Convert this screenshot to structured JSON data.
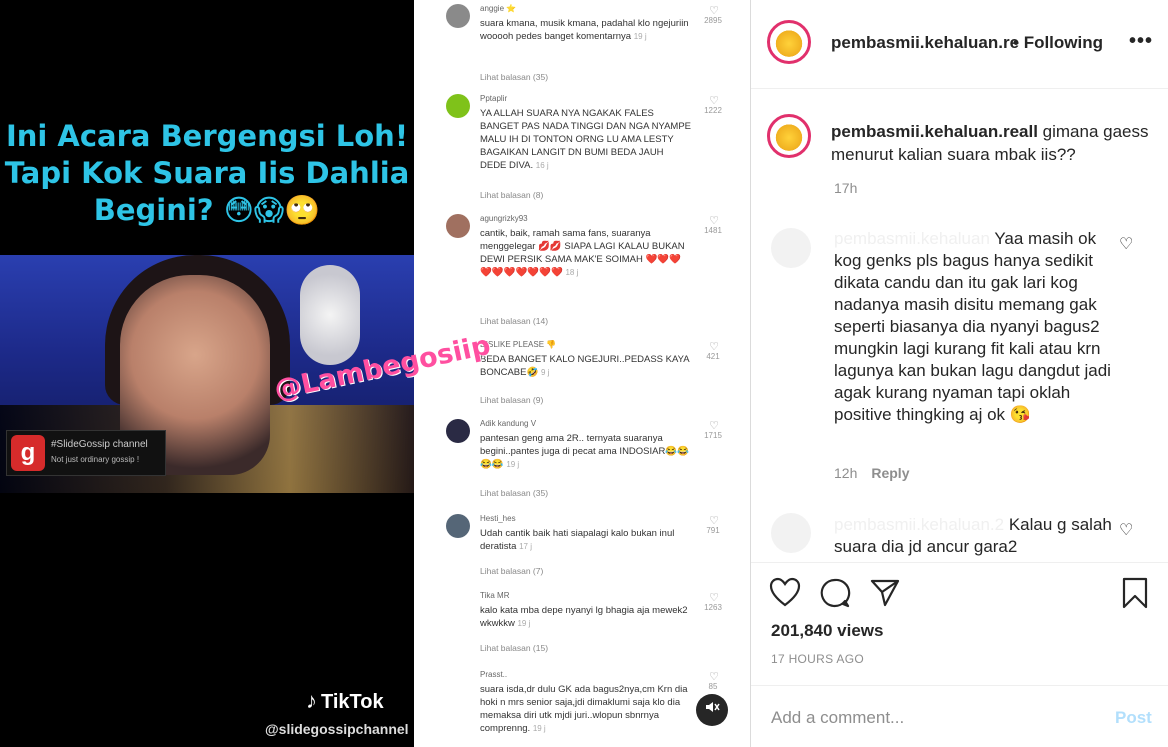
{
  "video": {
    "headline_lines": [
      "Ini Acara Bergengsi Loh!",
      "Tapi Kok Suara Iis Dahlia",
      "Begini? 😳😱🙄"
    ],
    "watermark": "@Lambegosiip",
    "channel_logo_line1": "#SlideGossip channel",
    "channel_logo_line2": "Not just ordinary gossip !",
    "tiktok_label": "TikTok",
    "tiktok_user": "@slidegossipchannel",
    "mute_icon": "mute-icon"
  },
  "video_comments": [
    {
      "user": "anggie ⭐",
      "text": "suara kmana, musik kmana, padahal klo ngejuriin wooooh pedes banget komentarnya",
      "time": "19 j",
      "likes": "2895",
      "replies": "Lihat balasan (35)",
      "avatar_color": "#8a8a8a"
    },
    {
      "user": "Pptaplir",
      "text": "YA ALLAH SUARA NYA NGAKAK FALES BANGET PAS NADA TINGGI DAN NGA NYAMPE MALU IH DI TONTON ORNG LU AMA LESTY BAGAIKAN LANGIT DN BUMI BEDA JAUH DEDE DIVA.",
      "time": "16 j",
      "likes": "1222",
      "replies": "Lihat balasan (8)",
      "avatar_color": "#7fc21a"
    },
    {
      "user": "agungrizky93",
      "text": "cantik, baik, ramah sama fans, suaranya menggelegar 💋💋 SIAPA LAGI KALAU BUKAN DEWI PERSIK SAMA MAK'E SOIMAH ❤️❤️❤️❤️❤️❤️❤️❤️❤️❤️",
      "time": "18 j",
      "likes": "1481",
      "replies": "Lihat balasan (14)",
      "avatar_color": "#a07060"
    },
    {
      "user": "DISLIKE PLEASE 👎",
      "text": "BEDA BANGET KALO NGEJURI..PEDASS KAYA BONCABE🤣",
      "time": "9 j",
      "likes": "421",
      "replies": "Lihat balasan (9)",
      "avatar_color": "#ffffff"
    },
    {
      "user": "Adik kandung V",
      "text": "pantesan geng ama 2R.. ternyata suaranya begini..pantes juga di pecat ama INDOSIAR😂😂😂😂",
      "time": "19 j",
      "likes": "1715",
      "replies": "Lihat balasan (35)",
      "avatar_color": "#2a2a44"
    },
    {
      "user": "Hesti_hes",
      "text": "Udah cantik baik hati siapalagi kalo bukan inul deratista",
      "time": "17 j",
      "likes": "791",
      "replies": "Lihat balasan (7)",
      "avatar_color": "#556677"
    },
    {
      "user": "Tika MR",
      "text": "kalo kata mba depe nyanyi lg bhagia aja mewek2 wkwkkw",
      "time": "19 j",
      "likes": "1263",
      "replies": "Lihat balasan (15)",
      "avatar_color": "#ffffff"
    },
    {
      "user": "Prasst..",
      "text": "suara isda,dr dulu GK ada bagus2nya,cm Krn dia hoki n mrs senior saja,jdi dimaklumi saja klo dia memaksa diri utk mjdi juri..wlopun sbnrnya comprenng.",
      "time": "19 j",
      "likes": "85",
      "replies": "",
      "avatar_color": "#ffffff"
    }
  ],
  "header": {
    "username": "pembasmii.kehaluan.re",
    "follow_sep": "•",
    "follow_label": "Following",
    "more_label": "•••",
    "avatar_text": "Pembasmi Kehaluan"
  },
  "caption": {
    "username": "pembasmii.kehaluan.reall",
    "text": "gimana gaess menurut kalian suara mbak iis??",
    "time": "17h"
  },
  "comment1": {
    "username_ghost": "pembasmii.kehaluan",
    "text": "Yaa masih ok kog genks pls bagus hanya sedikit dikata candu dan itu gak lari kog nadanya masih disitu memang gak seperti biasanya dia nyanyi bagus2 mungkin lagi kurang fit kali atau krn lagunya kan bukan lagu dangdut jadi agak kurang nyaman tapi oklah positive thingking aj ok 😘",
    "time": "12h",
    "reply_label": "Reply"
  },
  "comment2": {
    "username_ghost": "pembasmii.kehaluan.2",
    "text": "Kalau g salah suara dia jd ancur gara2"
  },
  "actions": {
    "views": "201,840 views",
    "posted_ago": "17 HOURS AGO",
    "add_comment_placeholder": "Add a comment...",
    "post_label": "Post"
  },
  "icons": [
    "heart-icon",
    "comment-icon",
    "share-icon",
    "bookmark-icon"
  ],
  "colors": {
    "headline": "#2ec4e6",
    "watermark": "#ff4fa0",
    "post_disabled": "#b2dffc",
    "muted_text": "#8e8e8e"
  }
}
